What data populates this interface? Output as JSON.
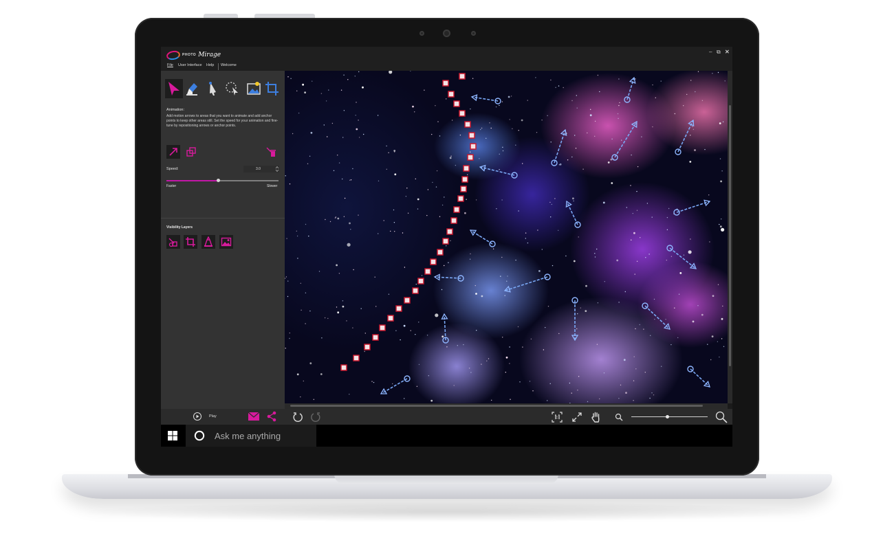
{
  "app": {
    "logo_small": "PHOTO",
    "logo_big": "Mirage",
    "window_controls": {
      "minimize": "–",
      "restore": "⧉",
      "close": "✕"
    }
  },
  "menu": [
    "File",
    "User Interface",
    "Help",
    "Welcome"
  ],
  "tools": [
    {
      "name": "animation-arrow-tool",
      "icon": "pink-arrow-cursor-icon",
      "active": true
    },
    {
      "name": "mask-tool",
      "icon": "eraser-icon",
      "active": false
    },
    {
      "name": "selection-tool",
      "icon": "pointer-brush-icon",
      "active": false
    },
    {
      "name": "lasso-tool",
      "icon": "lasso-cursor-icon",
      "active": false
    },
    {
      "name": "image-tool",
      "icon": "picture-sparkle-icon",
      "active": false
    },
    {
      "name": "crop-tool",
      "icon": "crop-icon",
      "active": false
    }
  ],
  "animation": {
    "heading": "Animation:",
    "description": "Add motion arrows to areas that you want to animate and add anchor points to keep other areas still. Set the speed for your animation and fine-tune by repositioning arrows or anchor points.",
    "speed_label": "Speed:",
    "speed_value": "3.0",
    "speed_level": 0.46,
    "faster_label": "Faster",
    "slower_label": "Slower"
  },
  "visibility": {
    "heading": "Visibility Layers"
  },
  "bottom": {
    "play_label": "Play",
    "zoom_level": 0.47
  },
  "taskbar": {
    "search_placeholder": "Ask me anything"
  },
  "colors": {
    "accent": "#c316a7",
    "arrow": "#2f63d8",
    "anchor": "#c8172c"
  }
}
